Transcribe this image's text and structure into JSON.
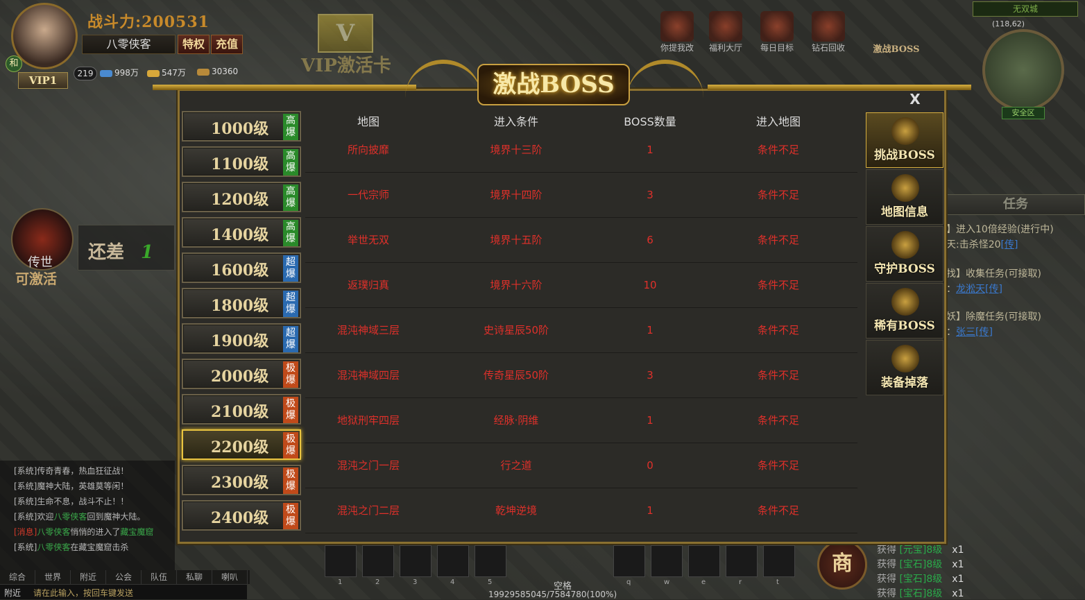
{
  "player": {
    "power_label": "战斗力:200531",
    "name": "八零侠客",
    "privilege": "特权",
    "recharge": "充值",
    "vip": "VIP1",
    "level": "219",
    "he": "和",
    "diamond": "998万",
    "gold": "547万",
    "coin": "30360"
  },
  "top": {
    "vip_card": "VIP激活卡",
    "vip_letter": "V",
    "icons": [
      {
        "label": "你提我改"
      },
      {
        "label": "福利大厅"
      },
      {
        "label": "每日目标"
      },
      {
        "label": "钻石回收"
      }
    ],
    "boss_icon": "激战BOSS",
    "map_name": "无双城",
    "coords": "(118,62)",
    "safe_zone": "安全区"
  },
  "left": {
    "chuanshi": "传世",
    "activate": "可激活",
    "haicha": "还差",
    "haicha_num": "1"
  },
  "task": {
    "title": "任务",
    "lines": [
      {
        "pre": "】进入10倍经验(进行中)"
      },
      {
        "pre": "天:击杀怪",
        "num": "20",
        "link": "[传]"
      },
      {
        "pre": "找】收集任务(可接取)"
      },
      {
        "pre": "：",
        "name": "龙淞天",
        "link": "[传]"
      },
      {
        "pre": "妖】除魔任务(可接取)"
      },
      {
        "pre": "：",
        "name": "张三",
        "link": "[传]"
      }
    ]
  },
  "chat": {
    "lines": [
      {
        "text": "[系统]传奇青春，热血狂征战！"
      },
      {
        "text": "[系统]魔神大陆，英雄莫等闲！"
      },
      {
        "text": "[系统]生命不息，战斗不止！！"
      },
      {
        "pre": "[系统]欢迎",
        "hl": "八零侠客",
        "post": "回到魔神大陆。"
      },
      {
        "red": "[消息]",
        "hl": "八零侠客",
        "post": "悄悄的进入了",
        "hl2": "藏宝魔窟"
      },
      {
        "pre": "[系统]",
        "hl": "八零侠客",
        "post": "在藏宝魔窟击杀"
      }
    ],
    "tabs": [
      "综合",
      "世界",
      "附近",
      "公会",
      "队伍",
      "私聊",
      "喇叭"
    ],
    "near": "附近",
    "placeholder": "请在此输入，按回车键发送"
  },
  "bottom": {
    "space": "空格",
    "exp": "19929585045/7584780(100%)",
    "shang": "商",
    "slots": [
      "1",
      "2",
      "3",
      "4",
      "5",
      "q",
      "w",
      "e",
      "r",
      "t"
    ],
    "gains": [
      {
        "label": "获得",
        "mid": "[元宝]8级",
        "x": "x1"
      },
      {
        "label": "获得",
        "mid": "[宝石]8级",
        "x": "x1"
      },
      {
        "label": "获得",
        "mid": "[宝石]8级",
        "x": "x1"
      },
      {
        "label": "获得",
        "mid": "[宝石]8级",
        "x": "x1"
      }
    ]
  },
  "dialog": {
    "title": "激战BOSS",
    "close": "X",
    "levels": [
      {
        "label": "1000级",
        "tag": "高爆",
        "color": "#2a8a2a"
      },
      {
        "label": "1100级",
        "tag": "高爆",
        "color": "#2a8a2a"
      },
      {
        "label": "1200级",
        "tag": "高爆",
        "color": "#2a8a2a"
      },
      {
        "label": "1400级",
        "tag": "高爆",
        "color": "#2a8a2a"
      },
      {
        "label": "1600级",
        "tag": "超爆",
        "color": "#2a6ab0"
      },
      {
        "label": "1800级",
        "tag": "超爆",
        "color": "#2a6ab0"
      },
      {
        "label": "1900级",
        "tag": "超爆",
        "color": "#2a6ab0"
      },
      {
        "label": "2000级",
        "tag": "极爆",
        "color": "#c04a1a"
      },
      {
        "label": "2100级",
        "tag": "极爆",
        "color": "#c04a1a"
      },
      {
        "label": "2200级",
        "tag": "极爆",
        "color": "#c04a1a",
        "selected": true
      },
      {
        "label": "2300级",
        "tag": "极爆",
        "color": "#c04a1a"
      },
      {
        "label": "2400级",
        "tag": "极爆",
        "color": "#c04a1a"
      }
    ],
    "columns": [
      "地图",
      "进入条件",
      "BOSS数量",
      "进入地图"
    ],
    "rows": [
      {
        "map": "所向披靡",
        "cond": "境界十三阶",
        "count": "1",
        "enter": "条件不足"
      },
      {
        "map": "一代宗师",
        "cond": "境界十四阶",
        "count": "3",
        "enter": "条件不足"
      },
      {
        "map": "举世无双",
        "cond": "境界十五阶",
        "count": "6",
        "enter": "条件不足"
      },
      {
        "map": "返璞归真",
        "cond": "境界十六阶",
        "count": "10",
        "enter": "条件不足"
      },
      {
        "map": "混沌神域三层",
        "cond": "史诗星辰50阶",
        "count": "1",
        "enter": "条件不足"
      },
      {
        "map": "混沌神域四层",
        "cond": "传奇星辰50阶",
        "count": "3",
        "enter": "条件不足"
      },
      {
        "map": "地狱刑牢四层",
        "cond": "经脉·阴维",
        "count": "1",
        "enter": "条件不足"
      },
      {
        "map": "混沌之门一层",
        "cond": "行之道",
        "count": "0",
        "enter": "条件不足"
      },
      {
        "map": "混沌之门二层",
        "cond": "乾坤逆境",
        "count": "1",
        "enter": "条件不足"
      }
    ],
    "tabs": [
      {
        "label": "挑战BOSS",
        "active": true
      },
      {
        "label": "地图信息"
      },
      {
        "label": "守护BOSS"
      },
      {
        "label": "稀有BOSS"
      },
      {
        "label": "装备掉落"
      }
    ]
  }
}
